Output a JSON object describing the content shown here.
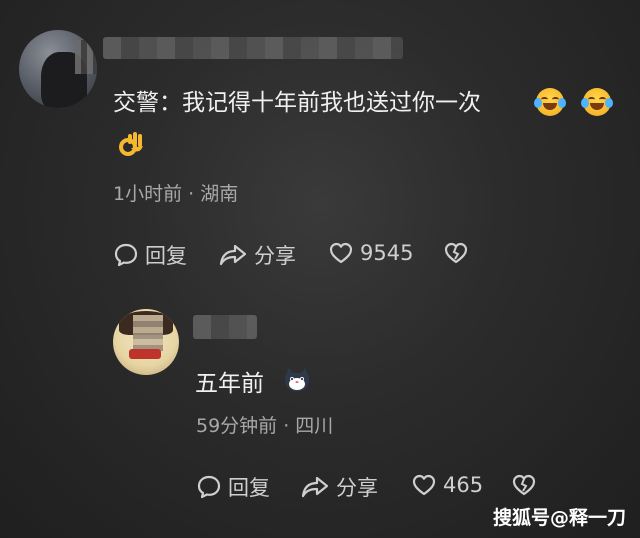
{
  "comment": {
    "text": "交警：我记得十年前我也送过你一次",
    "emojis": [
      "rolling-laughing-emoji",
      "rolling-laughing-emoji",
      "ok-hand-emoji"
    ],
    "meta": "1小时前 · 湖南",
    "reply_label": "回复",
    "share_label": "分享",
    "like_count": "9545"
  },
  "reply": {
    "text": "五年前",
    "emoji": "cat-emoji",
    "meta": "59分钟前 · 四川",
    "reply_label": "回复",
    "share_label": "分享",
    "like_count": "465"
  },
  "watermark": "搜狐号@释一刀",
  "colors": {
    "background": "#2c2c2c",
    "text_primary": "#f0f0f0",
    "text_secondary": "#a8a8a8"
  }
}
